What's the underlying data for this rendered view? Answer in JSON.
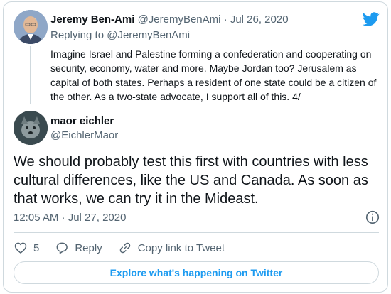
{
  "brand": {
    "logo_icon": "twitter-bird-icon",
    "accent": "#1d9bf0"
  },
  "quoted_tweet": {
    "author_name": "Jeremy Ben-Ami",
    "author_meta": "@JeremyBenAmi · Jul 26, 2020",
    "replying_to": "Replying to @JeremyBenAmi",
    "text": "Imagine Israel and Palestine forming a confederation and cooperating on security, economy, water and more. Maybe Jordan too? Jerusalem as capital of both states. Perhaps a resident of one state could be a citizen of the other. As a two-state advocate, I support all of this. 4/"
  },
  "tweet": {
    "author_name": "maor eichler",
    "author_handle": "@EichlerMaor",
    "text": "We should probably test this first with countries with less cultural differences, like the US and Canada. As soon as that works, we can try it in the Mideast.",
    "timestamp": "12:05 AM · Jul 27, 2020"
  },
  "actions": {
    "like_count": "5",
    "reply_label": "Reply",
    "copy_link_label": "Copy link to Tweet"
  },
  "explore_label": "Explore what's happening on Twitter"
}
